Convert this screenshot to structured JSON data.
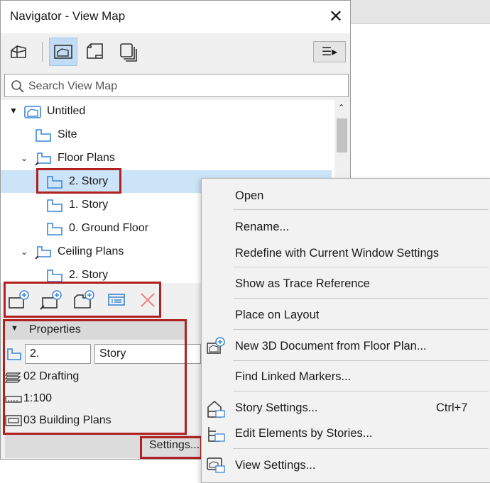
{
  "window": {
    "title": "Navigator - View Map",
    "close": "✕"
  },
  "search": {
    "placeholder": "Search View Map"
  },
  "tree": [
    {
      "label": "Untitled",
      "level": 0
    },
    {
      "label": "Site",
      "level": 1
    },
    {
      "label": "Floor Plans",
      "level": 1,
      "expanded": true
    },
    {
      "label": "2. Story",
      "level": 2,
      "selected": true
    },
    {
      "label": "1. Story",
      "level": 2
    },
    {
      "label": "0. Ground Floor",
      "level": 2
    },
    {
      "label": "Ceiling Plans",
      "level": 1,
      "expanded": true
    },
    {
      "label": "2. Story",
      "level": 2
    }
  ],
  "properties": {
    "header": "Properties",
    "id_value": "2.",
    "name_value": "Story",
    "layer_combo": "02 Drafting",
    "scale": "1:100",
    "model_view": "03 Building Plans",
    "settings_button": "Settings..."
  },
  "context_menu": {
    "items": [
      {
        "label": "Open"
      },
      {
        "label": "Rename..."
      },
      {
        "label": "Redefine with Current Window Settings"
      },
      {
        "label": "Show as Trace Reference"
      },
      {
        "label": "Place on Layout"
      },
      {
        "label": "New 3D Document from Floor Plan..."
      },
      {
        "label": "Find Linked Markers..."
      },
      {
        "label": "Story Settings...",
        "shortcut": "Ctrl+7"
      },
      {
        "label": "Edit Elements by Stories..."
      },
      {
        "label": "View Settings..."
      }
    ]
  },
  "colors": {
    "accent": "#3a86d6",
    "highlight": "#b02020",
    "selection": "#cce4f7",
    "delete": "#f08080"
  }
}
